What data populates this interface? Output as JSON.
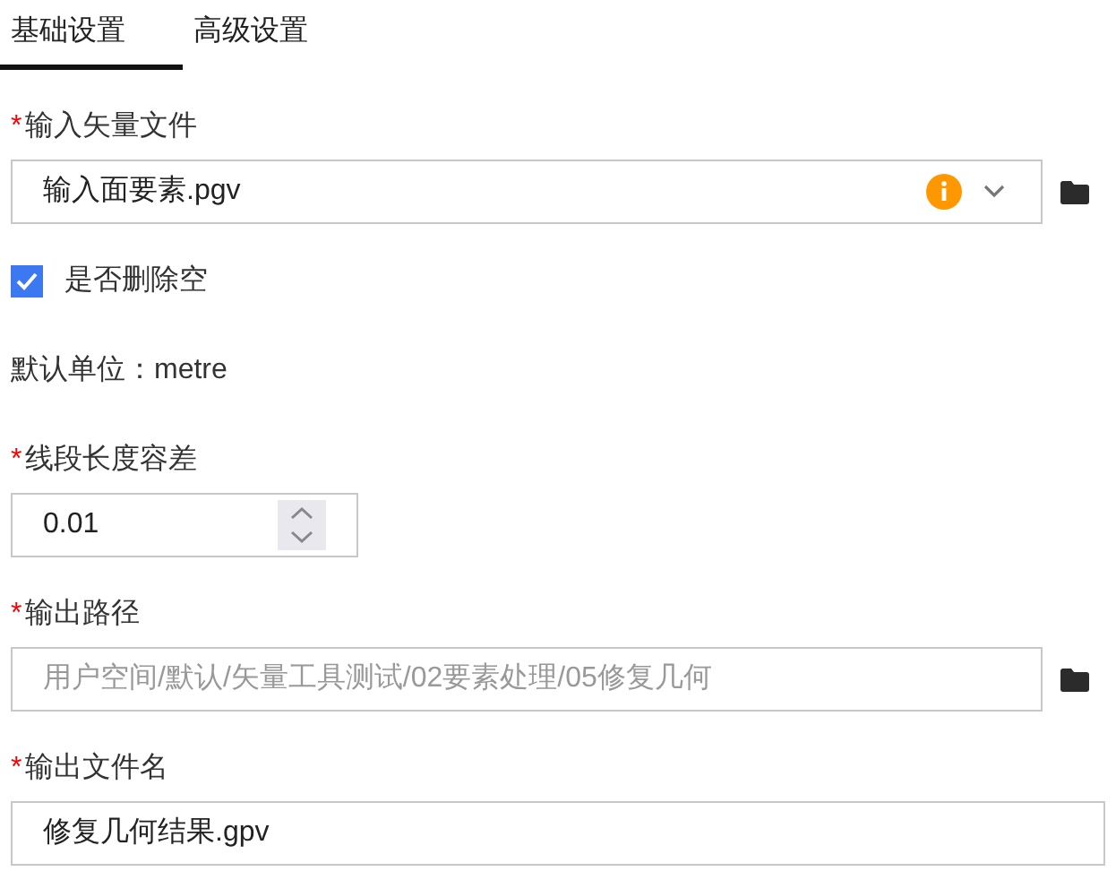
{
  "tabs": [
    {
      "label": "基础设置",
      "selected": true
    },
    {
      "label": "高级设置",
      "selected": false
    }
  ],
  "fields": [
    {
      "kind": "select",
      "mark": "*",
      "label": "输入矢量文件",
      "value": "输入面要素.pgv",
      "warning": true,
      "browse": true
    },
    {
      "kind": "checkbox",
      "label": "是否删除空",
      "checked": true
    },
    {
      "kind": "info",
      "text": "默认单位：metre"
    },
    {
      "kind": "number",
      "mark": "*",
      "label": "线段长度容差",
      "value": "0.01"
    },
    {
      "kind": "text",
      "mark": "*",
      "label": "输出路径",
      "placeholder": "用户空间/默认/矢量工具测试/02要素处理/05修复几何",
      "browse": true
    },
    {
      "kind": "text",
      "mark": "*",
      "label": "输出文件名",
      "value": "修复几何结果.gpv",
      "browse": false
    }
  ]
}
